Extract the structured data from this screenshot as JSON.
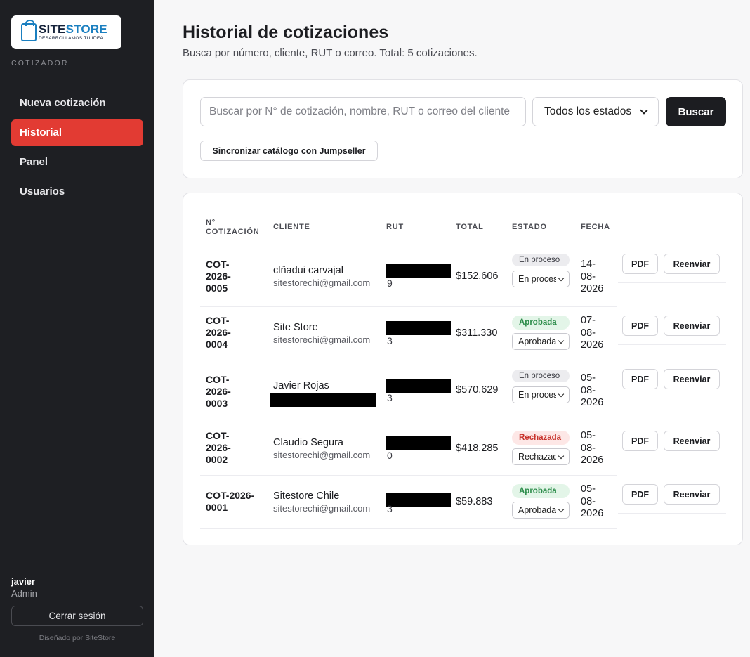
{
  "brand": {
    "logo_main": "SITE",
    "logo_accent": "STORE",
    "logo_tagline": "DESARROLLAMOS TU IDEA",
    "app_label": "COTIZADOR"
  },
  "nav": {
    "items": [
      {
        "label": "Nueva cotización",
        "active": false
      },
      {
        "label": "Historial",
        "active": true
      },
      {
        "label": "Panel",
        "active": false
      },
      {
        "label": "Usuarios",
        "active": false
      }
    ]
  },
  "user": {
    "name": "javier",
    "role": "Admin",
    "logout_label": "Cerrar sesión",
    "credit": "Diseñado por SiteStore"
  },
  "header": {
    "title": "Historial de cotizaciones",
    "subtitle": "Busca por número, cliente, RUT o correo. Total: 5 cotizaciones."
  },
  "search": {
    "placeholder": "Buscar por N° de cotización, nombre, RUT o correo del cliente",
    "value": "",
    "status_selected": "Todos los estados",
    "search_label": "Buscar",
    "sync_label": "Sincronizar catálogo con Jumpseller"
  },
  "table": {
    "headers": {
      "num": "N° COTIZACIÓN",
      "cliente": "CLIENTE",
      "rut": "RUT",
      "total": "TOTAL",
      "estado": "ESTADO",
      "fecha": "FECHA"
    },
    "pdf_label": "PDF",
    "resend_label": "Reenviar",
    "rows": [
      {
        "num": "COT-2026-0005",
        "client": "clñadui carvajal",
        "email": "sitestorechi@gmail.com",
        "rut_tail": "9",
        "total": "$152.606",
        "status": "En proceso",
        "status_kind": "proc",
        "select": "En proceso",
        "date": "14-08-2026"
      },
      {
        "num": "COT-2026-0004",
        "client": "Site Store",
        "email": "sitestorechi@gmail.com",
        "rut_tail": "3",
        "total": "$311.330",
        "status": "Aprobada",
        "status_kind": "aprob",
        "select": "Aprobada",
        "date": "07-08-2026"
      },
      {
        "num": "COT-2026-0003",
        "client": "Javier Rojas",
        "email": "",
        "rut_tail": "3",
        "total": "$570.629",
        "status": "En proceso",
        "status_kind": "proc",
        "select": "En proceso",
        "date": "05-08-2026"
      },
      {
        "num": "COT-2026-0002",
        "client": "Claudio Segura",
        "email": "sitestorechi@gmail.com",
        "rut_tail": "0",
        "total": "$418.285",
        "status": "Rechazada",
        "status_kind": "rech",
        "select": "Rechazada",
        "date": "05-08-2026"
      },
      {
        "num": "COT-2026-0001",
        "client": "Sitestore Chile",
        "email": "sitestorechi@gmail.com",
        "rut_tail": "3",
        "total": "$59.883",
        "status": "Aprobada",
        "status_kind": "aprob",
        "select": "Aprobada",
        "date": "05-08-2026"
      }
    ]
  }
}
